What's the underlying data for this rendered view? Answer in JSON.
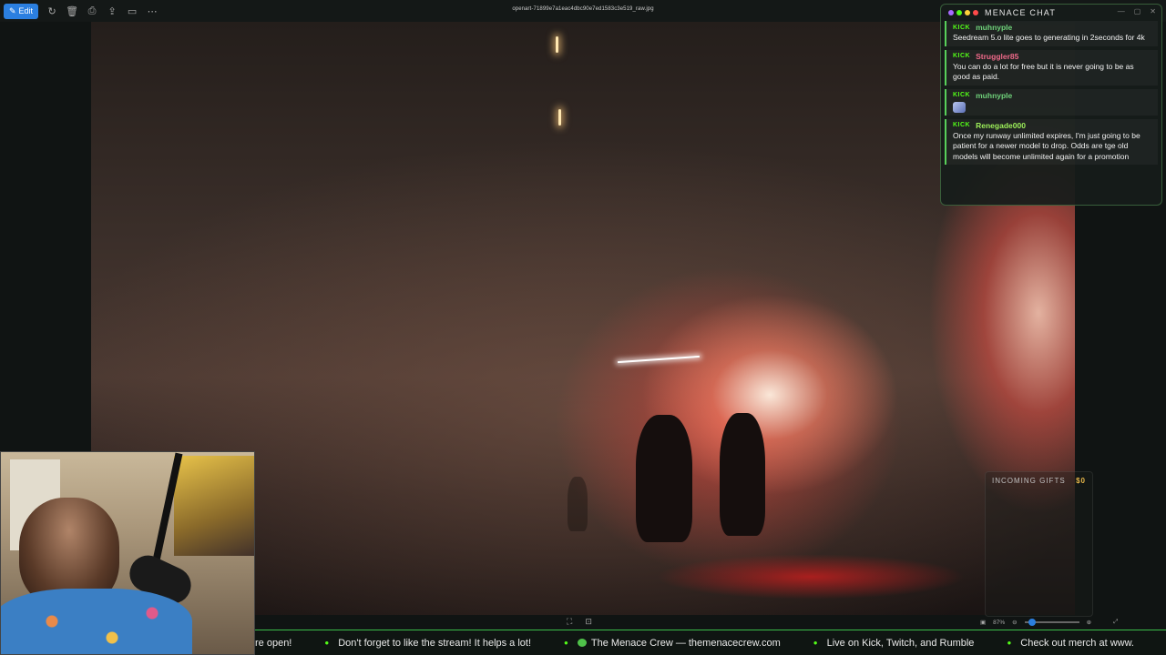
{
  "viewer": {
    "edit_label": "Edit",
    "filename": "openart-71899e7a1eac4dbc90e7ed1583c3e519_raw.jpg",
    "toolbar_icons": [
      "rotate-icon",
      "delete-icon",
      "print-icon",
      "share-icon",
      "slideshow-icon",
      "more-icon"
    ],
    "zoom_level": "87%"
  },
  "chat": {
    "title": "MENACE CHAT",
    "platform_badge": "KICK",
    "messages": [
      {
        "user": "muhnyple",
        "user_color": "#6fd17a",
        "text": "Seedream 5.o lite goes to generating in 2seconds for 4k"
      },
      {
        "user": "Struggler85",
        "user_color": "#f06a8a",
        "text": "You can do a lot for free but it is never going to be as good as paid."
      },
      {
        "user": "muhnyple",
        "user_color": "#6fd17a",
        "text": "",
        "has_emote": true
      },
      {
        "user": "Renegade000",
        "user_color": "#9df05a",
        "text": "Once my runway unlimited expires, I'm just going to be patient for a newer model to drop. Odds are tge old models will become unlimited again for a promotion"
      }
    ]
  },
  "gifts": {
    "title": "INCOMING GIFTS",
    "amount": "$0"
  },
  "ticker": {
    "items": [
      "re open!",
      "Don't forget to like the stream! It helps a lot!",
      "The Menace Crew — themenacecrew.com",
      "Live on Kick, Twitch, and Rumble",
      "Check out merch at www."
    ]
  },
  "colors": {
    "accent": "#53fc18",
    "edit_button": "#2b7fe0",
    "gift_amount": "#e8b84a"
  }
}
